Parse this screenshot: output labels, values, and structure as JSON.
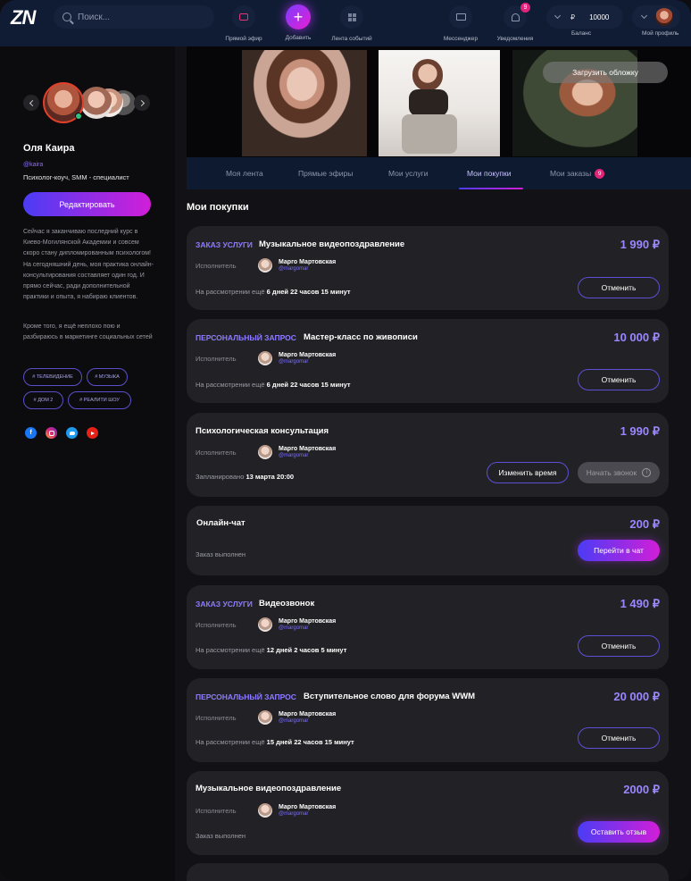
{
  "header": {
    "logo": "ZN",
    "search_placeholder": "Поиск...",
    "nav": {
      "live": "Прямой эфир",
      "add": "Добавить",
      "feed": "Лента событий",
      "messenger": "Мессенджер",
      "notifications": "Уведомления",
      "notifications_count": "9",
      "balance_label": "Баланс",
      "balance_currency": "₽",
      "balance_value": "10000",
      "profile": "Мой профиль"
    }
  },
  "profile": {
    "name": "Оля Каира",
    "handle": "@kaira",
    "role": "Психолог-коуч, SMM - специалист",
    "edit_label": "Редактировать",
    "bio_p1": "Сейчас я заканчиваю последний курс в Киево-Могилянской Академии и совсем скоро стану дипломированным психологом! На сегодняшний день, моя практика онлайн-консультирования составляет один год. И прямо сейчас, ради дополнительной практики и опыта, я набираю клиентов.",
    "bio_p2": "Кроме того, я ещё неплохо пою и разбираюсь в маркетинге социальных сетей",
    "tags": [
      "# ТЕЛЕВИДЕНИЕ",
      "# МУЗЫКА",
      "# ДОМ 2",
      "# РЕАЛИТИ ШОУ"
    ],
    "socials": [
      "facebook-icon",
      "instagram-icon",
      "twitter-icon",
      "youtube-icon"
    ]
  },
  "cover": {
    "upload_label": "Загрузить обложку"
  },
  "tabs": [
    {
      "label": "Моя лента"
    },
    {
      "label": "Прямые эфиры"
    },
    {
      "label": "Мои услуги"
    },
    {
      "label": "Мои покупки"
    },
    {
      "label": "Мои заказы",
      "badge": "9"
    }
  ],
  "section_title": "Мои покупки",
  "orders": [
    {
      "type": "ЗАКАЗ УСЛУГИ",
      "title": "Музыкальное видеопоздравление",
      "price": "1 990 ₽",
      "executor_label": "Исполнитель",
      "user_name": "Марго Мартовская",
      "user_handle": "@margomar",
      "status_prefix": "На рассмотрении ещё",
      "status_value": "6 дней 22 часов 15 минут",
      "action": "Отменить"
    },
    {
      "type": "ПЕРСОНАЛЬНЫЙ ЗАПРОС",
      "title": "Мастер-класс по живописи",
      "price": "10 000 ₽",
      "executor_label": "Исполнитель",
      "user_name": "Марго Мартовская",
      "user_handle": "@margomar",
      "status_prefix": "На рассмотрении ещё",
      "status_value": "6 дней 22 часов 15 минут",
      "action": "Отменить"
    },
    {
      "type": "",
      "title": "Психологическая консультация",
      "price": "1 990 ₽",
      "executor_label": "Исполнитель",
      "user_name": "Марго Мартовская",
      "user_handle": "@margomar",
      "status_prefix": "Запланировано",
      "status_value": "13 марта 20:00",
      "action": "Изменить время",
      "action2": "Начать звонок"
    },
    {
      "type": "",
      "title": "Онлайн-чат",
      "price": "200 ₽",
      "status_prefix": "Заказ выполнен",
      "status_value": "",
      "action": "Перейти в чат"
    },
    {
      "type": "ЗАКАЗ УСЛУГИ",
      "title": "Видеозвонок",
      "price": "1 490 ₽",
      "executor_label": "Исполнитель",
      "user_name": "Марго Мартовская",
      "user_handle": "@margomar",
      "status_prefix": "На рассмотрении ещё",
      "status_value": "12 дней 2 часов 5 минут",
      "action": "Отменить"
    },
    {
      "type": "ПЕРСОНАЛЬНЫЙ ЗАПРОС",
      "title": "Вступительное слово для форума WWM",
      "price": "20 000 ₽",
      "executor_label": "Исполнитель",
      "user_name": "Марго Мартовская",
      "user_handle": "@margomar",
      "status_prefix": "На рассмотрении ещё",
      "status_value": "15 дней 22 часов 15 минут",
      "action": "Отменить"
    },
    {
      "type": "",
      "title": "Музыкальное видеопоздравление",
      "price": "2000 ₽",
      "executor_label": "Исполнитель",
      "user_name": "Марго Мартовская",
      "user_handle": "@margomar",
      "status_prefix": "Заказ выполнен",
      "status_value": "",
      "action": "Оставить отзыв"
    }
  ],
  "colors": {
    "accent": "#8e7bff",
    "gradient_start": "#4b3cf5",
    "gradient_end": "#d21ed8",
    "header_bg": "#101c34"
  }
}
